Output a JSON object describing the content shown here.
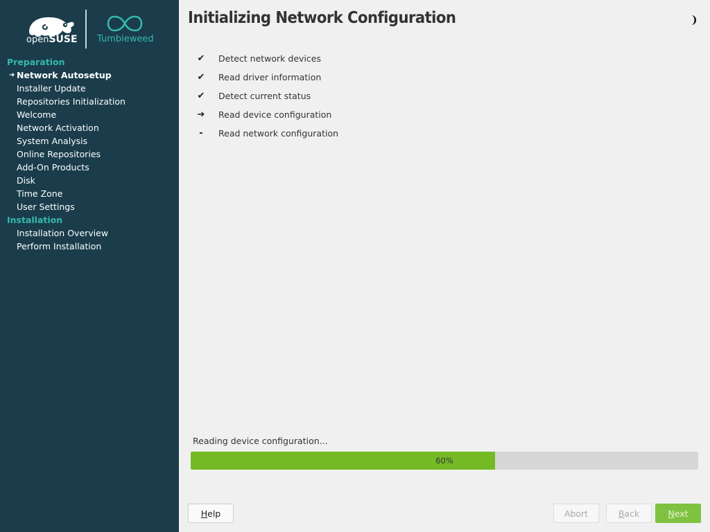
{
  "brand": {
    "suse_prefix": "open",
    "suse_name": "SUSE",
    "distro_name": "Tumbleweed",
    "colors": {
      "sidebar": "#1a3c4b",
      "accent": "#35b9ab",
      "progress": "#73ba25"
    }
  },
  "sidebar": {
    "groups": [
      {
        "label": "Preparation",
        "steps": [
          {
            "label": "Network Autosetup",
            "current": true,
            "marker": "➔"
          },
          {
            "label": "Installer Update"
          },
          {
            "label": "Repositories Initialization"
          },
          {
            "label": "Welcome"
          },
          {
            "label": "Network Activation"
          },
          {
            "label": "System Analysis"
          },
          {
            "label": "Online Repositories"
          },
          {
            "label": "Add-On Products"
          },
          {
            "label": "Disk"
          },
          {
            "label": "Time Zone"
          },
          {
            "label": "User Settings"
          }
        ]
      },
      {
        "label": "Installation",
        "steps": [
          {
            "label": "Installation Overview"
          },
          {
            "label": "Perform Installation"
          }
        ]
      }
    ]
  },
  "main": {
    "title": "Initializing Network Configuration",
    "theme_toggle_icon": "half-moon-icon",
    "tasks": [
      {
        "status": "✔",
        "state": "done",
        "label": "Detect network devices"
      },
      {
        "status": "✔",
        "state": "done",
        "label": "Read driver information"
      },
      {
        "status": "✔",
        "state": "done",
        "label": "Detect current status"
      },
      {
        "status": "➔",
        "state": "active",
        "label": "Read device configuration"
      },
      {
        "status": "-",
        "state": "pending",
        "label": "Read network configuration"
      }
    ],
    "progress": {
      "label": "Reading device configuration...",
      "value": 60,
      "text": "60%"
    }
  },
  "buttons": {
    "help": {
      "accel": "H",
      "rest": "elp",
      "enabled": true
    },
    "abort": {
      "accel": "",
      "rest": "Abort",
      "enabled": false
    },
    "back": {
      "accel": "B",
      "rest": "ack",
      "enabled": false
    },
    "next": {
      "accel": "N",
      "rest": "ext",
      "enabled": false
    }
  }
}
